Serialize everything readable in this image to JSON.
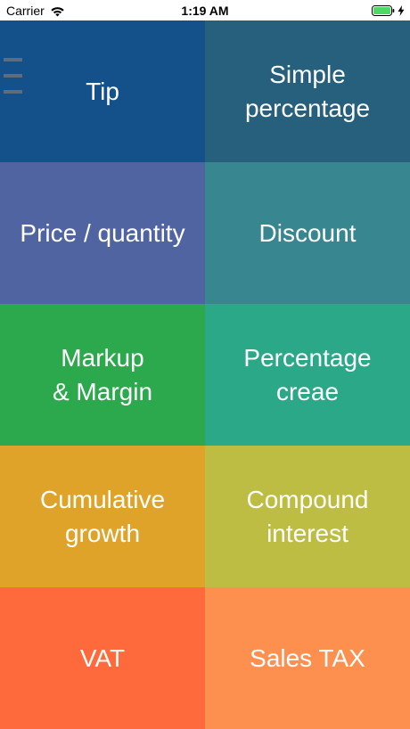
{
  "status_bar": {
    "carrier": "Carrier",
    "time": "1:19 AM",
    "battery_color": "#4cd964"
  },
  "menu": {
    "icon": "hamburger-menu-icon"
  },
  "tiles": [
    {
      "label": "Tip",
      "color": "#14518a"
    },
    {
      "label": "Simple\npercentage",
      "color": "#26607d"
    },
    {
      "label": "Price / quantity",
      "color": "#4f64a0"
    },
    {
      "label": "Discount",
      "color": "#388690"
    },
    {
      "label": "Markup\n& Margin",
      "color": "#2da94d"
    },
    {
      "label": "Percentage\ncreae",
      "color": "#2aa888"
    },
    {
      "label": "Cumulative\ngrowth",
      "color": "#dfa32a"
    },
    {
      "label": "Compound\ninterest",
      "color": "#bdbd44"
    },
    {
      "label": "VAT",
      "color": "#ff6a3c"
    },
    {
      "label": "Sales TAX",
      "color": "#fd8f4f"
    }
  ]
}
